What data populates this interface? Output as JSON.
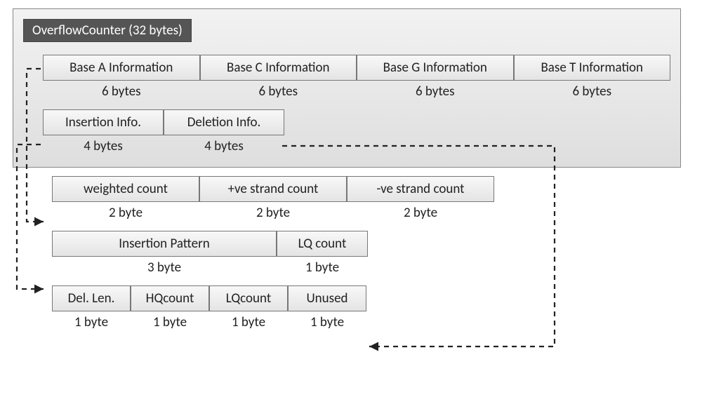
{
  "title": "OverflowCounter (32 bytes)",
  "row1": {
    "cells": [
      "Base A Information",
      "Base C Information",
      "Base G Information",
      "Base T Information"
    ],
    "sizes": [
      "6 bytes",
      "6 bytes",
      "6 bytes",
      "6 bytes"
    ]
  },
  "row2": {
    "cells": [
      "Insertion Info.",
      "Deletion Info."
    ],
    "sizes": [
      "4 bytes",
      "4 bytes"
    ]
  },
  "row3": {
    "cells": [
      "weighted count",
      "+ve strand count",
      "-ve strand count"
    ],
    "sizes": [
      "2 byte",
      "2 byte",
      "2 byte"
    ]
  },
  "row4": {
    "cells": [
      "Insertion Pattern",
      "LQ count"
    ],
    "sizes": [
      "3 byte",
      "1 byte"
    ]
  },
  "row5": {
    "cells": [
      "Del. Len.",
      "HQcount",
      "LQcount",
      "Unused"
    ],
    "sizes": [
      "1 byte",
      "1 byte",
      "1 byte",
      "1 byte"
    ]
  }
}
